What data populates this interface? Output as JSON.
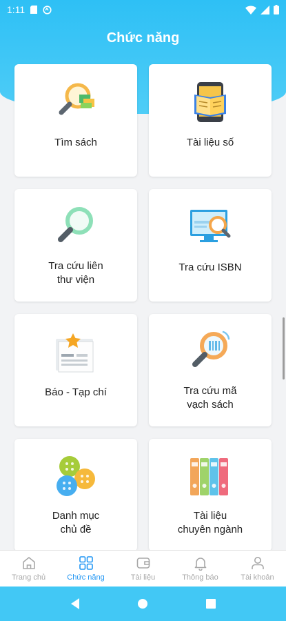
{
  "status_bar": {
    "time": "1:11"
  },
  "header": {
    "title": "Chức năng"
  },
  "features": [
    {
      "label": "Tìm sách",
      "icon": "book-search-icon"
    },
    {
      "label": "Tài liệu số",
      "icon": "digital-document-icon"
    },
    {
      "label": "Tra cứu liên\nthư viện",
      "icon": "magnifier-icon"
    },
    {
      "label": "Tra cứu ISBN",
      "icon": "isbn-lookup-icon"
    },
    {
      "label": "Báo - Tạp chí",
      "icon": "newspaper-icon"
    },
    {
      "label": "Tra cứu mã\nvạch sách",
      "icon": "barcode-search-icon"
    },
    {
      "label": "Danh mục\nchủ đề",
      "icon": "category-buttons-icon"
    },
    {
      "label": "Tài liệu\nchuyên ngành",
      "icon": "binders-icon"
    }
  ],
  "bottom_nav": [
    {
      "label": "Trang chủ",
      "icon": "home-icon",
      "active": false
    },
    {
      "label": "Chức năng",
      "icon": "grid-icon",
      "active": true
    },
    {
      "label": "Tài liệu",
      "icon": "wallet-icon",
      "active": false
    },
    {
      "label": "Thông báo",
      "icon": "bell-icon",
      "active": false
    },
    {
      "label": "Tài khoản",
      "icon": "user-icon",
      "active": false
    }
  ],
  "colors": {
    "header": "#2ec0f5",
    "active_nav": "#2196f3",
    "inactive_nav": "#a8a8a8"
  }
}
